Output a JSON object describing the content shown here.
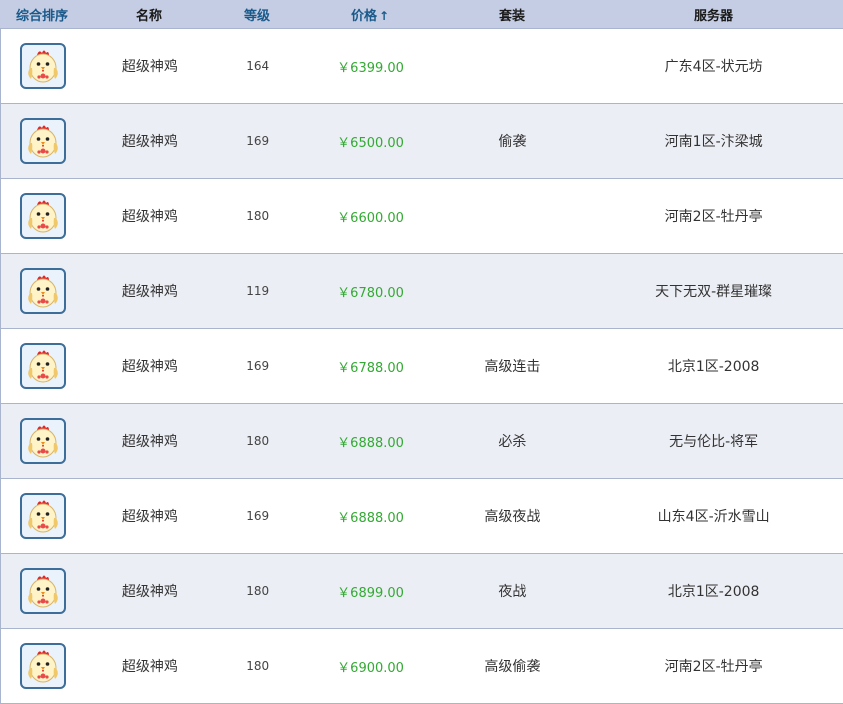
{
  "header": {
    "sort_label": "综合排序",
    "name_label": "名称",
    "level_label": "等级",
    "price_label": "价格",
    "price_sort_arrow": "↑",
    "suit_label": "套装",
    "server_label": "服务器"
  },
  "rows": [
    {
      "icon": "chicken-pet-icon",
      "name": "超级神鸡",
      "level": "164",
      "price": "￥6399.00",
      "suit": "",
      "server": "广东4区-状元坊"
    },
    {
      "icon": "chicken-pet-icon",
      "name": "超级神鸡",
      "level": "169",
      "price": "￥6500.00",
      "suit": "偷袭",
      "server": "河南1区-汴梁城"
    },
    {
      "icon": "chicken-pet-icon",
      "name": "超级神鸡",
      "level": "180",
      "price": "￥6600.00",
      "suit": "",
      "server": "河南2区-牡丹亭"
    },
    {
      "icon": "chicken-pet-icon",
      "name": "超级神鸡",
      "level": "119",
      "price": "￥6780.00",
      "suit": "",
      "server": "天下无双-群星璀璨"
    },
    {
      "icon": "chicken-pet-icon",
      "name": "超级神鸡",
      "level": "169",
      "price": "￥6788.00",
      "suit": "高级连击",
      "server": "北京1区-2008"
    },
    {
      "icon": "chicken-pet-icon",
      "name": "超级神鸡",
      "level": "180",
      "price": "￥6888.00",
      "suit": "必杀",
      "server": "无与伦比-将军"
    },
    {
      "icon": "chicken-pet-icon",
      "name": "超级神鸡",
      "level": "169",
      "price": "￥6888.00",
      "suit": "高级夜战",
      "server": "山东4区-沂水雪山"
    },
    {
      "icon": "chicken-pet-icon",
      "name": "超级神鸡",
      "level": "180",
      "price": "￥6899.00",
      "suit": "夜战",
      "server": "北京1区-2008"
    },
    {
      "icon": "chicken-pet-icon",
      "name": "超级神鸡",
      "level": "180",
      "price": "￥6900.00",
      "suit": "高级偷袭",
      "server": "河南2区-牡丹亭"
    }
  ],
  "colors": {
    "header_bg": "#c4cde3",
    "row_alt_bg": "#eceef5",
    "price_green": "#33aa33",
    "active_sort": "#1a5a8a"
  }
}
